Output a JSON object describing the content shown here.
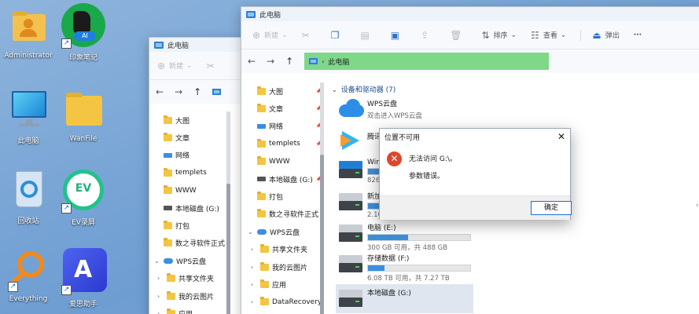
{
  "desktop": {
    "icons": [
      {
        "label": "Administrator",
        "icon": "user-folder-icon"
      },
      {
        "label": "印象笔记",
        "icon": "evernote-icon",
        "badge": "AI"
      },
      {
        "label": "此电脑",
        "icon": "monitor-icon"
      },
      {
        "label": "WanFile",
        "icon": "folder-icon"
      },
      {
        "label": "回收站",
        "icon": "recycle-bin-icon"
      },
      {
        "label": "EV录屏",
        "icon": "ev-recorder-icon",
        "badge": "EV"
      },
      {
        "label": "Everything",
        "icon": "search-magnifier-icon"
      },
      {
        "label": "爱思助手",
        "icon": "aisi-icon"
      }
    ]
  },
  "back_window": {
    "title": "此电脑",
    "toolbar": {
      "new_label": "新建"
    },
    "nav_items": [
      {
        "label": "大图",
        "type": "folder",
        "pinned": true
      },
      {
        "label": "文章",
        "type": "folder",
        "pinned": true
      },
      {
        "label": "网络",
        "type": "network",
        "pinned": true
      },
      {
        "label": "templets",
        "type": "folder",
        "pinned": true
      },
      {
        "label": "WWW",
        "type": "folder",
        "pinned": false
      },
      {
        "label": "本地磁盘 (G:)",
        "type": "drive",
        "pinned": true
      },
      {
        "label": "打包",
        "type": "folder",
        "pinned": false
      },
      {
        "label": "数之寻软件正式",
        "type": "folder",
        "pinned": false
      },
      {
        "label": "WPS云盘",
        "type": "cloud",
        "expanded": true
      },
      {
        "label": "共享文件夹",
        "type": "folder",
        "child": true
      },
      {
        "label": "我的云图片",
        "type": "folder",
        "child": true
      },
      {
        "label": "应用",
        "type": "folder",
        "child": true
      }
    ]
  },
  "front_window": {
    "title": "此电脑",
    "toolbar": {
      "new_label": "新建",
      "sort_label": "排序",
      "view_label": "查看",
      "eject_label": "弹出",
      "more_label": "···"
    },
    "address": "此电脑",
    "nav_items": [
      {
        "label": "大图",
        "type": "folder",
        "pinned": true
      },
      {
        "label": "文章",
        "type": "folder",
        "pinned": true
      },
      {
        "label": "网络",
        "type": "network",
        "pinned": true
      },
      {
        "label": "templets",
        "type": "folder",
        "pinned": true
      },
      {
        "label": "WWW",
        "type": "folder",
        "pinned": false
      },
      {
        "label": "本地磁盘 (G:)",
        "type": "drive",
        "pinned": true
      },
      {
        "label": "打包",
        "type": "folder",
        "pinned": false
      },
      {
        "label": "数之寻软件正式",
        "type": "folder",
        "pinned": false
      },
      {
        "label": "WPS云盘",
        "type": "cloud",
        "expanded": true
      },
      {
        "label": "共享文件夹",
        "type": "folder",
        "child": true
      },
      {
        "label": "我的云图片",
        "type": "folder",
        "child": true
      },
      {
        "label": "应用",
        "type": "folder",
        "child": true
      },
      {
        "label": "DataRecovery",
        "type": "folder",
        "child": true
      }
    ],
    "section_title": "设备和驱动器 (7)",
    "devices": [
      {
        "name": "WPS云盘",
        "sub": "双击进入WPS云盘",
        "icon": "wps-cloud-icon"
      },
      {
        "name": "腾讯",
        "sub": "",
        "icon": "tencent-video-icon"
      },
      {
        "name": "Win",
        "sub": "826",
        "icon": "windows-drive-icon",
        "used": 0.55
      },
      {
        "name": "新加",
        "sub": "2.16",
        "icon": "hdd-icon",
        "used": 0.92
      },
      {
        "name": "电脑 (E:)",
        "sub": "300 GB 可用，共 488 GB",
        "icon": "hdd-icon",
        "used": 0.39
      },
      {
        "name": "存储数据 (F:)",
        "sub": "6.08 TB 可用，共 7.27 TB",
        "icon": "hdd-icon",
        "used": 0.16
      },
      {
        "name": "本地磁盘 (G:)",
        "sub": "",
        "icon": "hdd-icon",
        "selected": true
      }
    ]
  },
  "dialog": {
    "title": "位置不可用",
    "message": "无法访问 G:\\。",
    "detail": "参数错误。",
    "ok_label": "确定",
    "close_glyph": "✕",
    "error_glyph": "✕"
  },
  "colors": {
    "accent": "#1e6fd0",
    "address_highlight": "#7fd88a",
    "error": "#e0452c",
    "bar_fill": "#3c8fdc"
  }
}
